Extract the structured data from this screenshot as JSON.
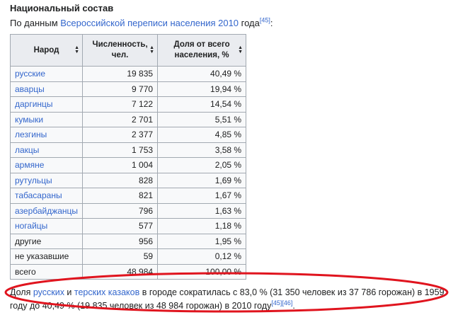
{
  "heading": "Национальный состав",
  "intro": {
    "prefix": "По данным ",
    "link": "Всероссийской переписи населения 2010",
    "suffix": " года",
    "ref": "[45]",
    "end": ":"
  },
  "table": {
    "headers": [
      "Народ",
      "Численность, чел.",
      "Доля от всего населения, %"
    ],
    "rows": [
      {
        "name": "русские",
        "count": "19 835",
        "share": "40,49 %",
        "link": true
      },
      {
        "name": "аварцы",
        "count": "9 770",
        "share": "19,94 %",
        "link": true
      },
      {
        "name": "даргинцы",
        "count": "7 122",
        "share": "14,54 %",
        "link": true
      },
      {
        "name": "кумыки",
        "count": "2 701",
        "share": "5,51 %",
        "link": true
      },
      {
        "name": "лезгины",
        "count": "2 377",
        "share": "4,85 %",
        "link": true
      },
      {
        "name": "лакцы",
        "count": "1 753",
        "share": "3,58 %",
        "link": true
      },
      {
        "name": "армяне",
        "count": "1 004",
        "share": "2,05 %",
        "link": true
      },
      {
        "name": "рутульцы",
        "count": "828",
        "share": "1,69 %",
        "link": true
      },
      {
        "name": "табасараны",
        "count": "821",
        "share": "1,67 %",
        "link": true
      },
      {
        "name": "азербайджанцы",
        "count": "796",
        "share": "1,63 %",
        "link": true
      },
      {
        "name": "ногайцы",
        "count": "577",
        "share": "1,18 %",
        "link": true
      },
      {
        "name": "другие",
        "count": "956",
        "share": "1,95 %",
        "link": false
      },
      {
        "name": "не указавшие",
        "count": "59",
        "share": "0,12 %",
        "link": false
      },
      {
        "name": "всего",
        "count": "48 984",
        "share": "100,00 %",
        "link": false
      }
    ]
  },
  "bottom": {
    "t1": "Доля ",
    "l1": "русских",
    "t2": " и ",
    "l2": "терских казаков",
    "t3": " в городе сократилась с 83,0 % (31 350 человек из 37 786 горожан) в 1959 году до 40,49 % (19 835 человек из 48 984 горожан) в 2010 году",
    "ref1": "[45]",
    "ref2": "[46]",
    "end": "."
  },
  "colors": {
    "link": "#3366cc",
    "annotation": "#e0141e",
    "header_bg": "#eaecf0",
    "border": "#a2a9b1"
  }
}
